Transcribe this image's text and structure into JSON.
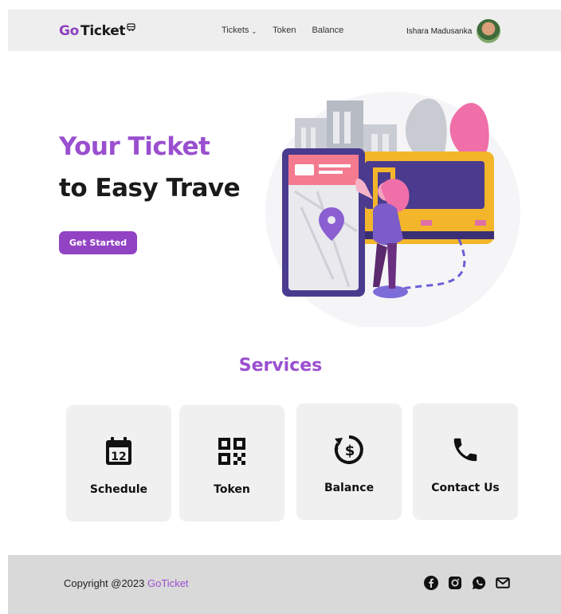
{
  "header": {
    "logo": {
      "prefix": "Go",
      "suffix": "Ticket",
      "icon": "bus-icon"
    },
    "nav": [
      {
        "label": "Tickets",
        "has_dropdown": true
      },
      {
        "label": "Token"
      },
      {
        "label": "Balance"
      }
    ],
    "user": {
      "name": "Ishara Madusanka"
    }
  },
  "hero": {
    "title_line1": "Your Ticket",
    "title_line2": "to Easy Trave",
    "cta_label": "Get Started"
  },
  "services": {
    "title": "Services",
    "cards": [
      {
        "label": "Schedule",
        "icon": "calendar-icon",
        "icon_text": "12"
      },
      {
        "label": "Token",
        "icon": "qr-code-icon"
      },
      {
        "label": "Balance",
        "icon": "dollar-refresh-icon"
      },
      {
        "label": "Contact Us",
        "icon": "phone-icon"
      }
    ]
  },
  "footer": {
    "copyright": "Copyright @2023",
    "brand": "GoTicket",
    "socials": [
      "facebook-icon",
      "instagram-icon",
      "whatsapp-icon",
      "mail-icon"
    ]
  },
  "colors": {
    "accent": "#9a4fcf",
    "button": "#9143c4",
    "header_bg": "#eeeeee",
    "footer_bg": "#d9d9d9",
    "card_bg": "#f0f0f0"
  }
}
